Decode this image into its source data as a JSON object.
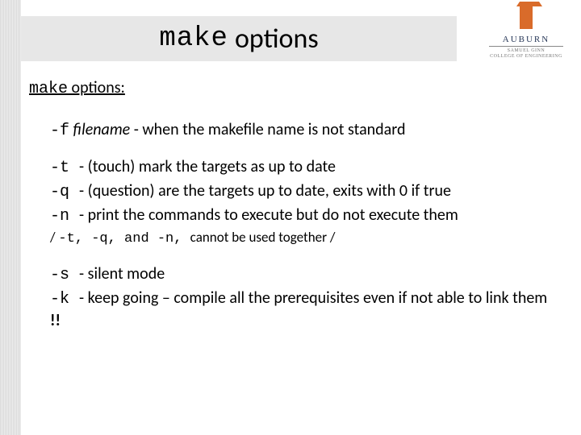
{
  "title": {
    "mono": "make",
    "rest": "options"
  },
  "logo": {
    "name": "AUBURN",
    "sub1": "SAMUEL GINN",
    "sub2": "COLLEGE OF ENGINEERING"
  },
  "subtitle": {
    "mono": "make",
    "rest": " options:"
  },
  "opt_f": {
    "flag": "-f",
    "arg": " filename",
    "dash": " - ",
    "desc": "when the makefile name is not standard"
  },
  "opt_t": {
    "flag": "-t ",
    "dash": "- ",
    "desc": "(touch) mark the targets as up to date"
  },
  "opt_q": {
    "flag": "-q ",
    "dash": "- ",
    "desc": "(question) are the targets up to date, exits with 0 if true"
  },
  "opt_n": {
    "flag": "-n ",
    "dash": "- ",
    "desc": "print the commands to execute but do not execute them"
  },
  "note": {
    "p1": "/ ",
    "p2": "-t, -q, ",
    "p3": "and",
    "p4": " -n, ",
    "p5": "cannot be used together /"
  },
  "opt_s": {
    "flag": "-s ",
    "dash": "- ",
    "desc": "silent mode"
  },
  "opt_k": {
    "flag": "-k ",
    "dash": "- ",
    "desc": "keep going – compile all the prerequisites even if not able to link them ",
    "excl": "!!"
  }
}
